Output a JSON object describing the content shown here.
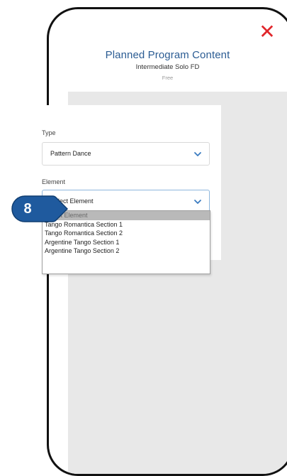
{
  "modal": {
    "title": "Planned Program Content",
    "subtitle": "Intermediate Solo FD",
    "price": "Free",
    "close_icon": "close-icon"
  },
  "form": {
    "type_label": "Type",
    "type_value": "Pattern Dance",
    "element_label": "Element",
    "element_value": "Select Element"
  },
  "dropdown": {
    "options": [
      "Select Element",
      "Tango Romantica Section 1",
      "Tango Romantica Section 2",
      "Argentine Tango Section 1",
      "Argentine Tango Section 2"
    ],
    "selected_index": 0
  },
  "callout": {
    "step": "8",
    "color": "#1f5a9e"
  },
  "colors": {
    "title": "#2b5c93",
    "close": "#e0262b",
    "chevron": "#3a7bc0"
  }
}
